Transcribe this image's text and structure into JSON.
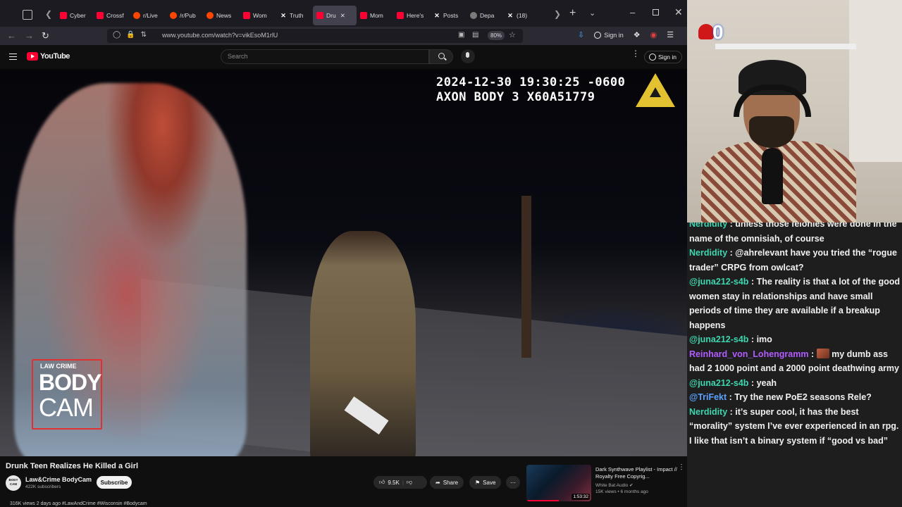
{
  "browser": {
    "tabs": [
      {
        "label": "Cyber",
        "favicon": "youtube-icon"
      },
      {
        "label": "Crossf",
        "favicon": "youtube-icon"
      },
      {
        "label": "r/Live",
        "favicon": "reddit-icon"
      },
      {
        "label": "/r/Pub",
        "favicon": "reddit-icon"
      },
      {
        "label": "News",
        "favicon": "reddit-icon"
      },
      {
        "label": "Wom",
        "favicon": "youtube-icon"
      },
      {
        "label": "Truth",
        "favicon": "x-icon"
      },
      {
        "label": "Dru",
        "favicon": "youtube-icon",
        "active": true
      },
      {
        "label": "Mom",
        "favicon": "youtube-icon"
      },
      {
        "label": "Here's",
        "favicon": "youtube-icon"
      },
      {
        "label": "Posts",
        "favicon": "x-icon"
      },
      {
        "label": "Depa",
        "favicon": "gear-icon"
      },
      {
        "label": "(18)",
        "favicon": "x-icon"
      }
    ],
    "url": "www.youtube.com/watch?v=vikEsoM1rlU",
    "zoom": "80%",
    "signin_label": "Sign in"
  },
  "youtube": {
    "logo_text": "YouTube",
    "search_placeholder": "Search",
    "signin_label": "Sign in",
    "video": {
      "timestamp": "2024-12-30 19:30:25 -0600",
      "camera_id": "AXON BODY 3 X60A51779",
      "watermark_top": "LAW CRIME",
      "watermark_line1": "BODY",
      "watermark_line2": "CAM"
    },
    "title": "Drunk Teen Realizes He Killed a Girl",
    "channel": {
      "avatar_text": "BODY CAM",
      "name": "Law&Crime BodyCam",
      "subscribers": "422K subscribers",
      "subscribe_label": "Subscribe"
    },
    "actions": {
      "likes": "9.5K",
      "share_label": "Share",
      "save_label": "Save"
    },
    "meta_line": "316K views  2 days ago  #LawAndCrime #Wisconsin #Bodycam",
    "recommendation": {
      "title": "Dark Synthwave Playlist - Impact // Royalty Free Copyrig...",
      "channel": "White Bat Audio",
      "meta": "15K views • 6 months ago",
      "duration": "1:53:32",
      "watched_fraction": 0.5
    }
  },
  "stream_overlay": {
    "counter": "0"
  },
  "chat": {
    "messages": [
      {
        "user": "Nerdidity",
        "color": "#3ed6b0",
        "text": "unless those felonies were done in the name of the omnisiah, of course"
      },
      {
        "user": "Nerdidity",
        "color": "#3ed6b0",
        "text": "@ahrelevant have you tried the “rogue trader” CRPG from owlcat?"
      },
      {
        "user": "@juna212-s4b",
        "color": "#3ed6b0",
        "text": "The reality is that a lot of the good women stay in relationships and have small periods of time they are available if a breakup happens"
      },
      {
        "user": "@juna212-s4b",
        "color": "#3ed6b0",
        "text": "imo"
      },
      {
        "user": "Reinhard_von_Lohengramm",
        "color": "#b15cff",
        "text": "my dumb ass had 2 1000 point and a 2000 point deathwing army",
        "emote": true
      },
      {
        "user": "@juna212-s4b",
        "color": "#3ed6b0",
        "text": "yeah"
      },
      {
        "user": "@TriFekt",
        "color": "#5aa0ff",
        "text": "Try the new PoE2 seasons Rele?"
      },
      {
        "user": "Nerdidity",
        "color": "#3ed6b0",
        "text": "it’s super cool, it has the best “morality” system I’ve ever experienced in an rpg. I like that isn’t a binary system if “good vs bad”"
      }
    ]
  }
}
